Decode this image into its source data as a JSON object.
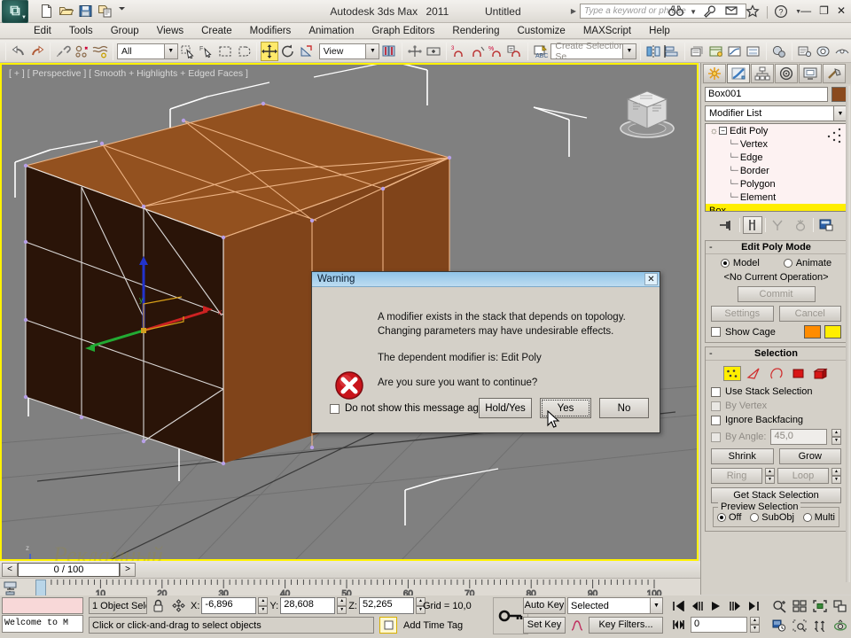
{
  "app": {
    "product": "Autodesk 3ds Max",
    "version": "2011",
    "document": "Untitled",
    "app_button_glyph": "ʘ"
  },
  "titlebar": {
    "quick_access": [
      {
        "name": "new-file-icon",
        "label": "New"
      },
      {
        "name": "open-file-icon",
        "label": "Open"
      },
      {
        "name": "save-file-icon",
        "label": "Save"
      },
      {
        "name": "save-copy-icon",
        "label": "Save Copy"
      },
      {
        "name": "customize-qat-icon",
        "label": "Customize Quick Access Toolbar"
      }
    ],
    "search_placeholder": "Type a keyword or phrase",
    "search_value": "",
    "right_icons": [
      {
        "name": "binoculars-icon",
        "label": "Search"
      },
      {
        "name": "wrench-icon",
        "label": "Subscription Center"
      },
      {
        "name": "communication-center-icon",
        "label": "Communication Center"
      },
      {
        "name": "favorites-star-icon",
        "label": "Favorites"
      },
      {
        "name": "help-icon",
        "label": "Help"
      }
    ],
    "window_buttons": [
      {
        "name": "minimize-button",
        "glyph": "—"
      },
      {
        "name": "restore-button",
        "glyph": "❐"
      },
      {
        "name": "close-button",
        "glyph": "✕"
      }
    ]
  },
  "menubar": {
    "items": [
      "Edit",
      "Tools",
      "Group",
      "Views",
      "Create",
      "Modifiers",
      "Animation",
      "Graph Editors",
      "Rendering",
      "Customize",
      "MAXScript",
      "Help"
    ]
  },
  "toolbar": {
    "selection_filter": "All",
    "reference_coordinate": "View",
    "named_selection_set_placeholder": "Create Selection Se",
    "named_selection_set_value": "",
    "buttons": [
      {
        "name": "undo-button",
        "label": "Undo",
        "active": false
      },
      {
        "name": "redo-button",
        "label": "Redo",
        "active": false
      },
      {
        "name": "select-link-button",
        "label": "Select and Link",
        "active": false
      },
      {
        "name": "unlink-selection-button",
        "label": "Unlink Selection",
        "active": false
      },
      {
        "name": "bind-space-warp-button",
        "label": "Bind to Space Warp",
        "active": false
      },
      {
        "name": "select-object-button",
        "label": "Select Object",
        "active": false
      },
      {
        "name": "select-by-name-button",
        "label": "Select by Name",
        "active": false
      },
      {
        "name": "rectangular-selection-region-button",
        "label": "Rectangular Selection Region",
        "active": false
      },
      {
        "name": "window-crossing-button",
        "label": "Window/Crossing",
        "active": false
      },
      {
        "name": "select-and-move-button",
        "label": "Select and Move",
        "active": true
      },
      {
        "name": "select-and-rotate-button",
        "label": "Select and Rotate",
        "active": false
      },
      {
        "name": "select-and-scale-button",
        "label": "Select and Uniform Scale",
        "active": false
      },
      {
        "name": "use-pivot-center-button",
        "label": "Use Pivot Point Center",
        "active": false
      },
      {
        "name": "select-and-manipulate-button",
        "label": "Select and Manipulate",
        "active": false
      },
      {
        "name": "keyboard-shortcut-override-button",
        "label": "Keyboard Shortcut Override Toggle",
        "active": false
      },
      {
        "name": "snaps-toggle-button",
        "label": "Snaps Toggle",
        "active": false
      },
      {
        "name": "angle-snap-toggle-button",
        "label": "Angle Snap Toggle",
        "active": false
      },
      {
        "name": "percent-snap-toggle-button",
        "label": "Percent Snap Toggle",
        "active": false
      },
      {
        "name": "spinner-snap-toggle-button",
        "label": "Spinner Snap Toggle",
        "active": false
      },
      {
        "name": "edit-named-selection-sets-button",
        "label": "Edit Named Selection Sets",
        "active": false
      },
      {
        "name": "mirror-button",
        "label": "Mirror",
        "active": false
      },
      {
        "name": "align-button",
        "label": "Align",
        "active": false
      },
      {
        "name": "layer-manager-button",
        "label": "Layer Manager",
        "active": false
      },
      {
        "name": "graphite-modeling-tools-button",
        "label": "Toggle Ribbon",
        "active": false
      },
      {
        "name": "curve-editor-button",
        "label": "Curve Editor",
        "active": false
      },
      {
        "name": "schematic-view-button",
        "label": "Schematic View",
        "active": false
      },
      {
        "name": "material-editor-button",
        "label": "Material Editor",
        "active": false
      },
      {
        "name": "render-setup-button",
        "label": "Render Setup",
        "active": false
      },
      {
        "name": "rendered-frame-window-button",
        "label": "Rendered Frame Window",
        "active": false
      },
      {
        "name": "render-production-button",
        "label": "Render Production",
        "active": false
      }
    ]
  },
  "viewport": {
    "label": "[ + ] [ Perspective ] [ Smooth + Highlights + Edged Faces ]",
    "background": "#808080",
    "border_color": "#fff200",
    "object_color": "#8a4a1e",
    "edge_color": "#f2b98a",
    "gizmo": {
      "x": "#cc2222",
      "y": "#22aa33",
      "z": "#2233cc"
    }
  },
  "command_panel": {
    "tabs": [
      {
        "name": "create-tab",
        "label": "Create",
        "active": false
      },
      {
        "name": "modify-tab",
        "label": "Modify",
        "active": true
      },
      {
        "name": "hierarchy-tab",
        "label": "Hierarchy",
        "active": false
      },
      {
        "name": "motion-tab",
        "label": "Motion",
        "active": false
      },
      {
        "name": "display-tab",
        "label": "Display",
        "active": false
      },
      {
        "name": "utilities-tab",
        "label": "Utilities",
        "active": false
      }
    ],
    "object_name": "Box001",
    "object_color": "#8a4a1e",
    "modifier_list_label": "Modifier List",
    "stack": [
      {
        "label": "Edit Poly",
        "type": "modifier",
        "selected": false
      },
      {
        "label": "Vertex",
        "type": "subobject",
        "selected": false
      },
      {
        "label": "Edge",
        "type": "subobject",
        "selected": false
      },
      {
        "label": "Border",
        "type": "subobject",
        "selected": false
      },
      {
        "label": "Polygon",
        "type": "subobject",
        "selected": false
      },
      {
        "label": "Element",
        "type": "subobject",
        "selected": false
      },
      {
        "label": "Box",
        "type": "base",
        "selected": true
      }
    ],
    "stack_buttons": [
      {
        "name": "pin-stack-button",
        "label": "Pin Stack",
        "enabled": true,
        "framed": false
      },
      {
        "name": "show-end-result-button",
        "label": "Show End Result",
        "enabled": true,
        "framed": true
      },
      {
        "name": "make-unique-button",
        "label": "Make Unique",
        "enabled": false,
        "framed": false
      },
      {
        "name": "remove-modifier-button",
        "label": "Remove Modifier from the Stack",
        "enabled": false,
        "framed": false
      },
      {
        "name": "configure-modifier-sets-button",
        "label": "Configure Modifier Sets",
        "enabled": true,
        "framed": false
      }
    ],
    "edit_poly_mode": {
      "title": "Edit Poly Mode",
      "model_label": "Model",
      "animate_label": "Animate",
      "model_selected": true,
      "animate_selected": false,
      "current_operation": "<No Current Operation>",
      "commit_label": "Commit",
      "settings_label": "Settings",
      "cancel_label": "Cancel",
      "show_cage_label": "Show Cage",
      "show_cage_checked": false,
      "cage_color_1": "#ff8c00",
      "cage_color_2": "#ffee00"
    },
    "selection": {
      "title": "Selection",
      "subobject_icons": [
        {
          "name": "vertex-subobject-button",
          "label": "Vertex",
          "active": true
        },
        {
          "name": "edge-subobject-button",
          "label": "Edge",
          "active": false
        },
        {
          "name": "border-subobject-button",
          "label": "Border",
          "active": false
        },
        {
          "name": "polygon-subobject-button",
          "label": "Polygon",
          "active": false
        },
        {
          "name": "element-subobject-button",
          "label": "Element",
          "active": false
        }
      ],
      "use_stack_selection_label": "Use Stack Selection",
      "use_stack_selection_checked": false,
      "by_vertex_label": "By Vertex",
      "by_vertex_checked": false,
      "by_vertex_enabled": false,
      "ignore_backfacing_label": "Ignore Backfacing",
      "ignore_backfacing_checked": false,
      "by_angle_label": "By Angle:",
      "by_angle_checked": false,
      "by_angle_value": "45,0",
      "shrink_label": "Shrink",
      "grow_label": "Grow",
      "ring_label": "Ring",
      "loop_label": "Loop",
      "get_stack_selection_label": "Get Stack Selection",
      "preview_selection_title": "Preview Selection",
      "preview_off_label": "Off",
      "preview_subobj_label": "SubObj",
      "preview_multi_label": "Multi",
      "preview_selected": "Off"
    }
  },
  "dialog": {
    "title": "Warning",
    "close_glyph": "✕",
    "line1": "A modifier exists in the stack that depends on topology.",
    "line2": "Changing parameters may have undesirable effects.",
    "line3": "The dependent modifier is:  Edit Poly",
    "line4": "Are you sure you want to continue?",
    "checkbox_label": "Do not show this message again",
    "checkbox_checked": false,
    "buttons": [
      {
        "name": "hold-yes-button",
        "label": "Hold/Yes",
        "focused": false
      },
      {
        "name": "yes-button",
        "label": "Yes",
        "focused": true
      },
      {
        "name": "no-button",
        "label": "No",
        "focused": false
      }
    ]
  },
  "trackbar": {
    "prev_glyph": "<",
    "next_glyph": ">",
    "frame_display": "0 / 100",
    "ruler_labels": [
      "10",
      "20",
      "30",
      "40",
      "50",
      "60",
      "70",
      "80",
      "90",
      "100"
    ]
  },
  "statusbar": {
    "listener_text": "Welcome to M",
    "selection_status": "1 Object Sele",
    "prompt": "Click or click-and-drag to select objects",
    "coords": [
      {
        "name": "x-coordinate-field",
        "axis": "X:",
        "value": "-6,896"
      },
      {
        "name": "y-coordinate-field",
        "axis": "Y:",
        "value": "28,608"
      },
      {
        "name": "z-coordinate-field",
        "axis": "Z:",
        "value": "52,265"
      }
    ],
    "grid_label": "Grid = 10,0",
    "add_time_tag": "Add Time Tag",
    "auto_key_label": "Auto Key",
    "set_key_label": "Set Key",
    "key_mode_value": "Selected",
    "key_filters_label": "Key Filters...",
    "current_frame": "0",
    "playback_buttons": [
      {
        "name": "go-to-start-button",
        "label": "Go to Start"
      },
      {
        "name": "previous-frame-button",
        "label": "Previous Frame"
      },
      {
        "name": "play-animation-button",
        "label": "Play Animation"
      },
      {
        "name": "next-frame-button",
        "label": "Next Frame"
      },
      {
        "name": "go-to-end-button",
        "label": "Go to End"
      },
      {
        "name": "key-mode-toggle-button",
        "label": "Key Mode Toggle"
      }
    ],
    "nav_buttons": [
      {
        "name": "zoom-button",
        "label": "Zoom"
      },
      {
        "name": "zoom-all-button",
        "label": "Zoom All"
      },
      {
        "name": "zoom-extents-button",
        "label": "Zoom Extents"
      },
      {
        "name": "zoom-extents-all-button",
        "label": "Zoom Extents All"
      },
      {
        "name": "field-of-view-button",
        "label": "Field-of-View"
      },
      {
        "name": "pan-view-button",
        "label": "Pan View"
      },
      {
        "name": "orbit-button",
        "label": "Orbit"
      },
      {
        "name": "maximize-viewport-button",
        "label": "Maximize Viewport Toggle"
      },
      {
        "name": "time-configuration-button",
        "label": "Time Configuration"
      }
    ]
  },
  "watermark": {
    "line1": "Рекламный",
    "line2": "агент",
    "line3": "Ogasda.ru"
  }
}
